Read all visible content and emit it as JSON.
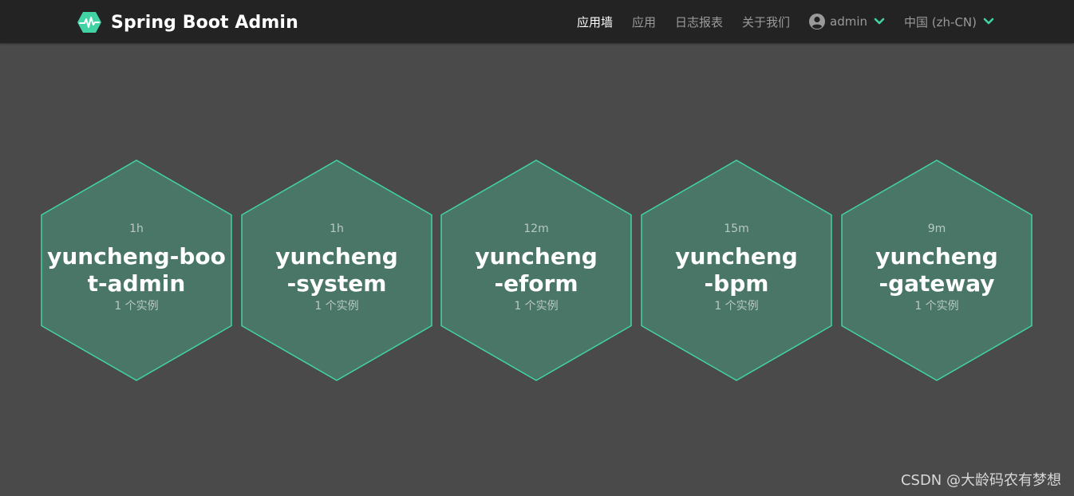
{
  "brand": {
    "title": "Spring Boot Admin",
    "logo_icon": "heartbeat-hexagon-icon",
    "logo_color": "#42d3a5"
  },
  "nav": {
    "items": [
      {
        "label": "应用墙",
        "active": true
      },
      {
        "label": "应用",
        "active": false
      },
      {
        "label": "日志报表",
        "active": false
      },
      {
        "label": "关于我们",
        "active": false
      }
    ],
    "user": {
      "label": "admin",
      "icon": "user-circle-icon"
    },
    "language": {
      "label": "中国 (zh-CN)"
    },
    "accent_color": "#42d3a5"
  },
  "applications": [
    {
      "uptime": "1h",
      "name": "yuncheng-boot-admin",
      "instances": "1 个实例"
    },
    {
      "uptime": "1h",
      "name": "yuncheng-system",
      "instances": "1 个实例"
    },
    {
      "uptime": "12m",
      "name": "yuncheng-eform",
      "instances": "1 个实例"
    },
    {
      "uptime": "15m",
      "name": "yuncheng-bpm",
      "instances": "1 个实例"
    },
    {
      "uptime": "9m",
      "name": "yuncheng-gateway",
      "instances": "1 个实例"
    }
  ],
  "colors": {
    "background": "#4a4a4a",
    "navbar": "#232323",
    "hex_fill": "#4a7667",
    "hex_border": "#42d3a5"
  },
  "watermark": "CSDN @大龄码农有梦想"
}
